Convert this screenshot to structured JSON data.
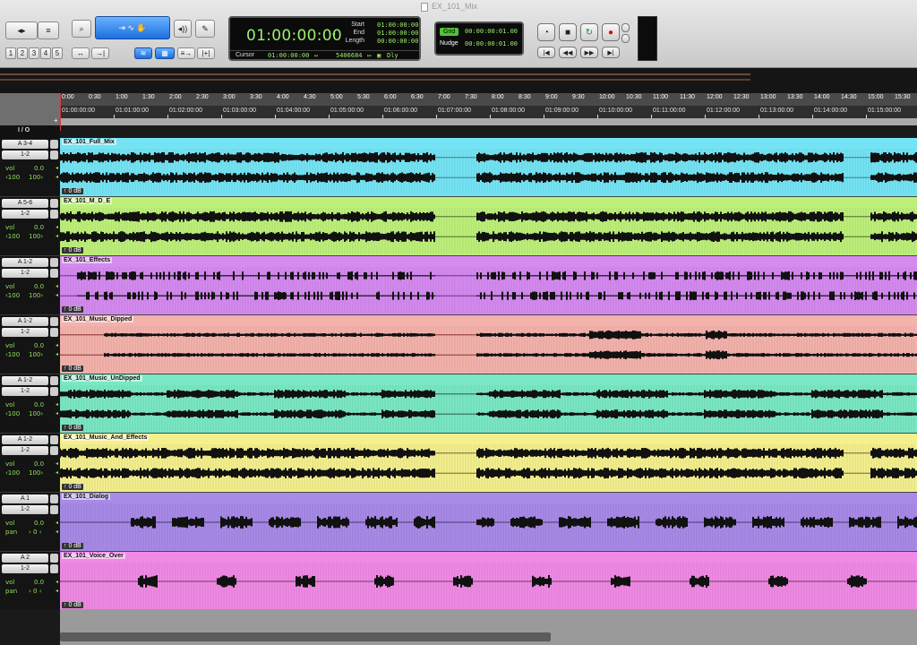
{
  "window": {
    "title": "EX_101_Mix"
  },
  "toolbar": {
    "mode_buttons": [
      "1",
      "2",
      "3",
      "4",
      "5"
    ],
    "counter": {
      "main": "01:00:00:00",
      "start_label": "Start",
      "end_label": "End",
      "length_label": "Length",
      "start": "01:00:00:00",
      "end": "01:00:00:00",
      "length": "00:00:00:00",
      "cursor_label": "Cursor",
      "cursor_value": "01:00:00:00",
      "sample_value": "5406684",
      "dly_label": "Dly"
    },
    "grid": {
      "label": "Grid",
      "value": "00:00:00:01.00"
    },
    "nudge": {
      "label": "Nudge",
      "value": "00:00:00:01.00"
    }
  },
  "ruler": {
    "minsec": [
      "0:00",
      "0:30",
      "1:00",
      "1:30",
      "2:00",
      "2:30",
      "3:00",
      "3:30",
      "4:00",
      "4:30",
      "5:00",
      "5:30",
      "6:00",
      "6:30",
      "7:00",
      "7:30",
      "8:00",
      "8:30",
      "9:00",
      "9:30",
      "10:00",
      "10:30",
      "11:00",
      "11:30",
      "12:00",
      "12:30",
      "13:00",
      "13:30",
      "14:00",
      "14:30",
      "15:00",
      "15:30"
    ],
    "timecode": [
      "01:00:00:00",
      "01:01:00:00",
      "01:02:00:00",
      "01:03:00:00",
      "01:04:00:00",
      "01:05:00:00",
      "01:06:00:00",
      "01:07:00:00",
      "01:08:00:00",
      "01:09:00:00",
      "01:10:00:00",
      "01:11:00:00",
      "01:12:00:00",
      "01:13:00:00",
      "01:14:00:00",
      "01:15:00:00"
    ]
  },
  "io": {
    "header": "I / O",
    "plus": "+"
  },
  "tracks": [
    {
      "name": "EX_101_Full_Mix",
      "input": "A 3-4",
      "output": "1-2",
      "param": "vol",
      "param_value": "0.0",
      "pan_l": "‹100",
      "pan_r": "100›",
      "gain": "0 dB",
      "color": "#74e4f4",
      "wave": "#3a6a78",
      "stereo": true,
      "style": "dense"
    },
    {
      "name": "EX_101_M_D_E",
      "input": "A 5-6",
      "output": "1-2",
      "param": "vol",
      "param_value": "0.0",
      "pan_l": "‹100",
      "pan_r": "100›",
      "gain": "0 dB",
      "color": "#bdf07a",
      "wave": "#3d5a26",
      "stereo": true,
      "style": "dense"
    },
    {
      "name": "EX_101_Effects",
      "input": "A 1-2",
      "output": "1-2",
      "param": "vol",
      "param_value": "0.0",
      "pan_l": "‹100",
      "pan_r": "100›",
      "gain": "0 dB",
      "color": "#d58af0",
      "wave": "#5a2a70",
      "stereo": true,
      "style": "sparse"
    },
    {
      "name": "EX_101_Music_Dipped",
      "input": "A 1-2",
      "output": "1-2",
      "param": "vol",
      "param_value": "0.0",
      "pan_l": "‹100",
      "pan_r": "100›",
      "gain": "0 dB",
      "color": "#f4b2ac",
      "wave": "#7a1e1e",
      "stereo": true,
      "style": "dipped"
    },
    {
      "name": "EX_101_Music_UnDipped",
      "input": "A 1-2",
      "output": "1-2",
      "param": "vol",
      "param_value": "0.0",
      "pan_l": "‹100",
      "pan_r": "100›",
      "gain": "0 dB",
      "color": "#7ae8c4",
      "wave": "#1e4a3c",
      "stereo": true,
      "style": "blocks"
    },
    {
      "name": "EX_101_Music_And_Effects",
      "input": "A 1-2",
      "output": "1-2",
      "param": "vol",
      "param_value": "0.0",
      "pan_l": "‹100",
      "pan_r": "100›",
      "gain": "0 dB",
      "color": "#f4f08e",
      "wave": "#5a5420",
      "stereo": true,
      "style": "dense"
    },
    {
      "name": "EX_101_Dialog",
      "input": "A 1",
      "output": "1-2",
      "param": "vol",
      "param_value": "0.0",
      "pan_l": "pan",
      "pan_r": "› 0 ‹",
      "gain": "0 dB",
      "color": "#a88ae8",
      "wave": "#2a1e4a",
      "stereo": false,
      "style": "dialog"
    },
    {
      "name": "EX_101_Voice_Over",
      "input": "A 2",
      "output": "1-2",
      "param": "vol",
      "param_value": "0.0",
      "pan_l": "pan",
      "pan_r": "› 0 ‹",
      "gain": "0 dB",
      "color": "#f08ae4",
      "wave": "#4a1e46",
      "stereo": false,
      "style": "vo"
    }
  ]
}
